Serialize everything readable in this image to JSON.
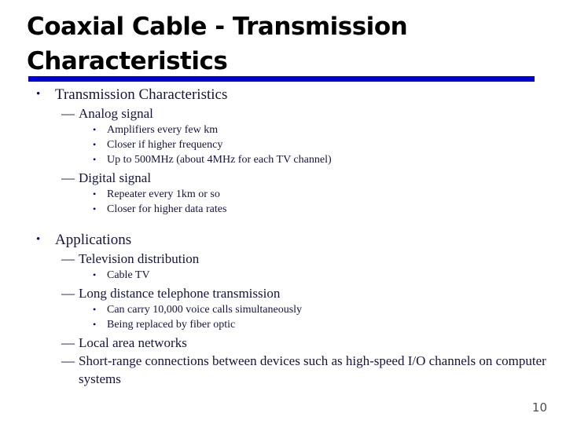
{
  "slide": {
    "title": "Coaxial Cable - Transmission Characteristics",
    "page_number": "10",
    "accent_color": "#0000CC",
    "bullet_color": "#00008B",
    "text_color": "#14143c",
    "outline": [
      {
        "level": 1,
        "marker": "•",
        "text": "Transmission Characteristics"
      },
      {
        "level": 2,
        "marker": "—",
        "text": "Analog signal"
      },
      {
        "level": 3,
        "marker": "•",
        "text": "Amplifiers every few km"
      },
      {
        "level": 3,
        "marker": "•",
        "text": "Closer if higher frequency"
      },
      {
        "level": 3,
        "marker": "•",
        "text": "Up to 500MHz (about 4MHz for each TV channel)"
      },
      {
        "level": 2,
        "marker": "—",
        "text": "Digital signal"
      },
      {
        "level": 3,
        "marker": "•",
        "text": "Repeater every 1km or so"
      },
      {
        "level": 3,
        "marker": "•",
        "text": "Closer for higher data rates"
      },
      {
        "level": 1,
        "marker": "•",
        "text": "Applications"
      },
      {
        "level": 2,
        "marker": "—",
        "text": "Television distribution"
      },
      {
        "level": 3,
        "marker": "•",
        "text": "Cable TV"
      },
      {
        "level": 2,
        "marker": "—",
        "text": "Long distance telephone transmission"
      },
      {
        "level": 3,
        "marker": "•",
        "text": "Can carry 10,000 voice calls simultaneously"
      },
      {
        "level": 3,
        "marker": "•",
        "text": "Being replaced by fiber optic"
      },
      {
        "level": 2,
        "marker": "—",
        "text": "Local area networks"
      },
      {
        "level": 2,
        "marker": "—",
        "text": "Short-range connections between devices such as high-speed I/O channels on computer systems"
      }
    ]
  }
}
